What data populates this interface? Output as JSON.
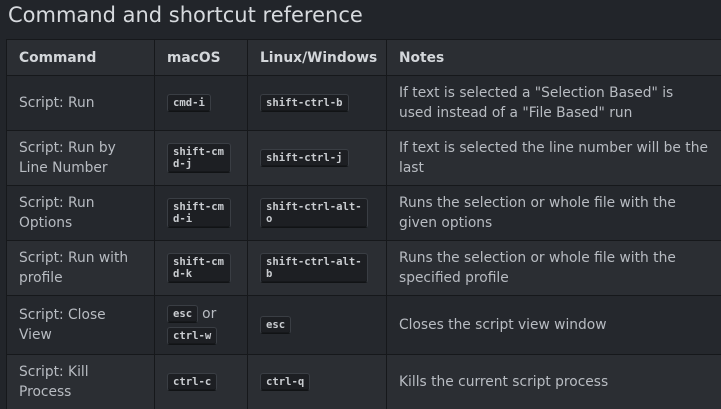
{
  "title": "Command and shortcut reference",
  "table": {
    "headers": [
      "Command",
      "macOS",
      "Linux/Windows",
      "Notes"
    ],
    "rows": [
      {
        "command": "Script: Run",
        "mac": "cmd-i",
        "linux": "shift-ctrl-b",
        "notes": "If text is selected a \"Selection Based\" is used instead of a \"File Based\" run"
      },
      {
        "command": "Script: Run by Line Number",
        "mac": "shift-cmd-j",
        "linux": "shift-ctrl-j",
        "notes": "If text is selected the line number will be the last"
      },
      {
        "command": "Script: Run Options",
        "mac": "shift-cmd-i",
        "linux": "shift-ctrl-alt-o",
        "notes": "Runs the selection or whole file with the given options"
      },
      {
        "command": "Script: Run with profile",
        "mac": "shift-cmd-k",
        "linux": "shift-ctrl-alt-b",
        "notes": "Runs the selection or whole file with the specified profile"
      },
      {
        "command": "Script: Close View",
        "mac": "esc",
        "mac_or": "or",
        "mac_alt": "ctrl-w",
        "linux": "esc",
        "notes": "Closes the script view window"
      },
      {
        "command": "Script: Kill Process",
        "mac": "ctrl-c",
        "linux": "ctrl-q",
        "notes": "Kills the current script process"
      }
    ]
  }
}
